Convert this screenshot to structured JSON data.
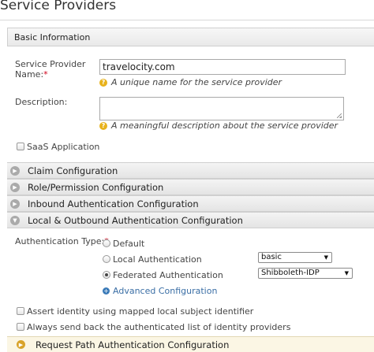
{
  "page": {
    "title": "Service Providers"
  },
  "basic_info": {
    "header": "Basic Information",
    "sp_name_label_line1": "Service Provider",
    "sp_name_label_line2": "Name:",
    "required_mark": "*",
    "sp_name_value": "travelocity.com",
    "sp_name_hint": "A unique name for the service provider",
    "description_label": "Description:",
    "description_value": "",
    "description_hint": "A meaningful description about the service provider",
    "saas_label": "SaaS Application",
    "hint_icon": "question-icon"
  },
  "accordions": [
    {
      "label": "Claim Configuration",
      "state": "collapsed"
    },
    {
      "label": "Role/Permission Configuration",
      "state": "collapsed"
    },
    {
      "label": "Inbound Authentication Configuration",
      "state": "collapsed"
    },
    {
      "label": "Local & Outbound Authentication Configuration",
      "state": "expanded"
    }
  ],
  "auth": {
    "type_label": "Authentication Type:",
    "required_mark": "*",
    "options": [
      {
        "label": "Default",
        "selected": false
      },
      {
        "label": "Local Authentication",
        "selected": false
      },
      {
        "label": "Federated Authentication",
        "selected": true
      }
    ],
    "local_select_value": "basic",
    "federated_select_value": "Shibboleth-IDP",
    "advanced_link": "Advanced Configuration",
    "assert_identity_label": "Assert identity using mapped local subject identifier",
    "send_back_label": "Always send back the authenticated list of identity providers"
  },
  "request_path": {
    "label": "Request Path Authentication Configuration",
    "state": "collapsed"
  },
  "colors": {
    "link": "#3a6ea5",
    "required": "#d0021b",
    "hint_icon": "#e8b21c",
    "request_arrow": "#d8a32a"
  }
}
